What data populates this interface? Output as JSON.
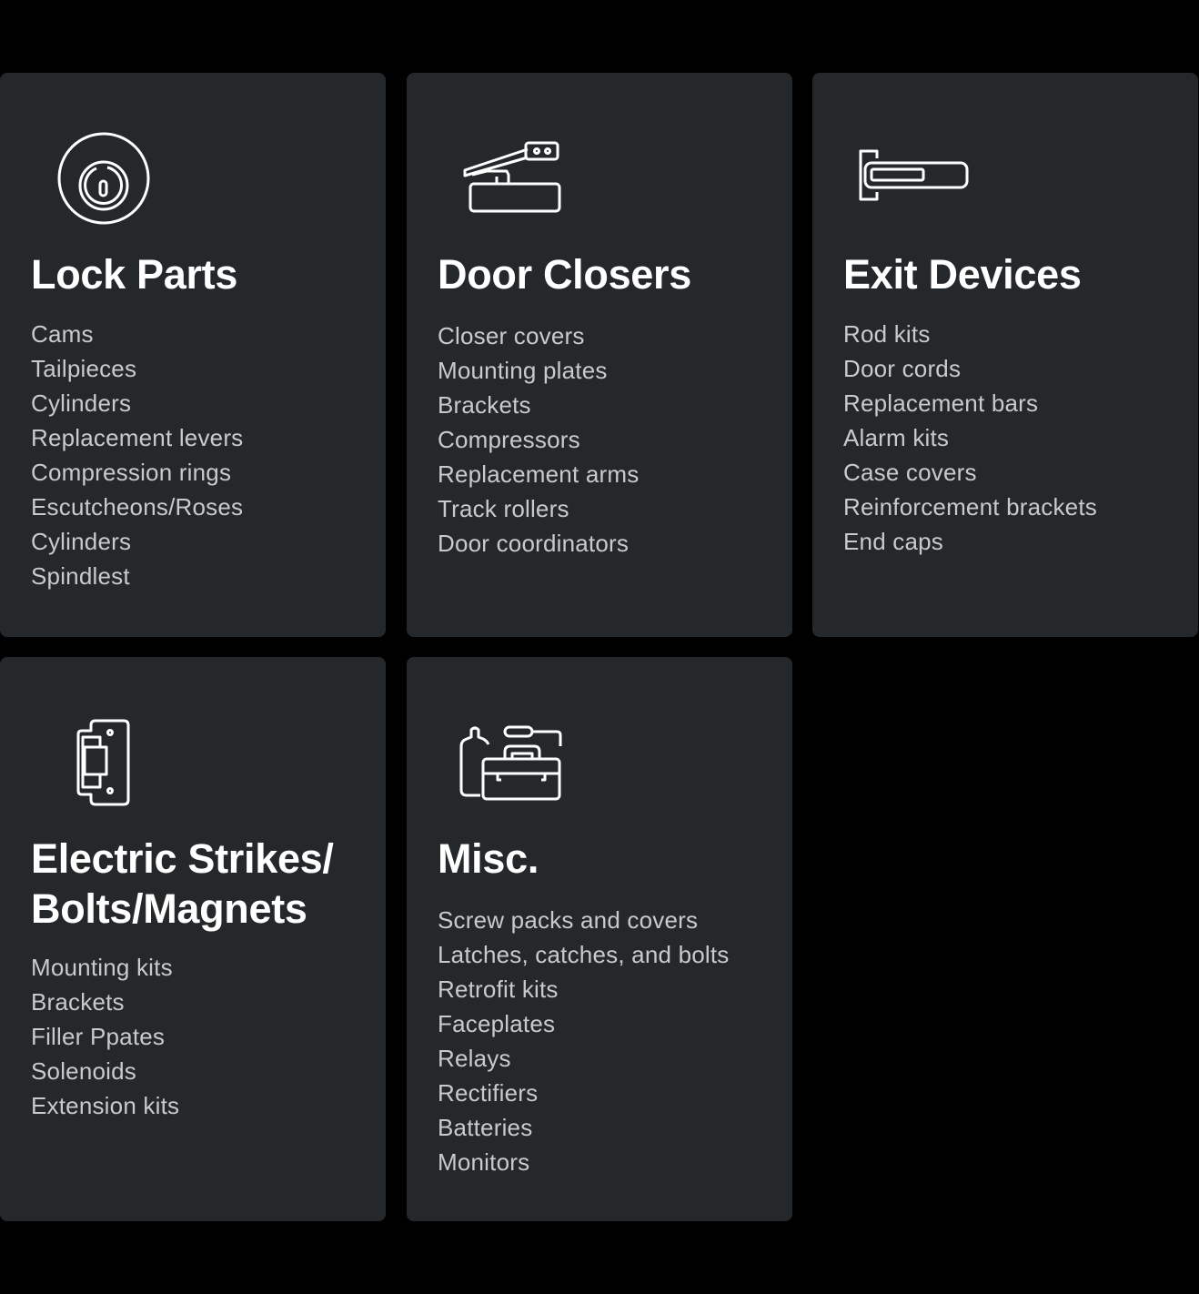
{
  "colors": {
    "page_background": "#000000",
    "card_background": "#25282b",
    "title": "#ffffff",
    "item_text": "#c9cacb",
    "icon_stroke": "#ffffff"
  },
  "cards": [
    {
      "icon": "lock-cylinder-icon",
      "title": "Lock Parts",
      "items": [
        "Cams",
        "Tailpieces",
        "Cylinders",
        "Replacement levers",
        "Compression rings",
        "Escutcheons/Roses",
        "Cylinders",
        "Spindlest"
      ]
    },
    {
      "icon": "door-closer-icon",
      "title": "Door Closers",
      "items": [
        "Closer covers",
        "Mounting plates",
        "Brackets",
        "Compressors",
        "Replacement arms",
        "Track rollers",
        "Door coordinators"
      ]
    },
    {
      "icon": "exit-device-bar-icon",
      "title": "Exit Devices",
      "items": [
        "Rod kits",
        "Door cords",
        "Replacement bars",
        "Alarm kits",
        "Case covers",
        "Reinforcement brackets",
        "End caps"
      ]
    },
    {
      "icon": "electric-strike-icon",
      "title_line1": "Electric Strikes/",
      "title_line2": "Bolts/Magnets",
      "items": [
        "Mounting kits",
        "Brackets",
        "Filler Ppates",
        "Solenoids",
        "Extension kits"
      ]
    },
    {
      "icon": "toolbox-icon",
      "title": "Misc.",
      "items": [
        "Screw packs and covers",
        "Latches, catches, and bolts",
        "Retrofit kits",
        "Faceplates",
        "Relays",
        "Rectifiers",
        "Batteries",
        "Monitors"
      ]
    }
  ]
}
